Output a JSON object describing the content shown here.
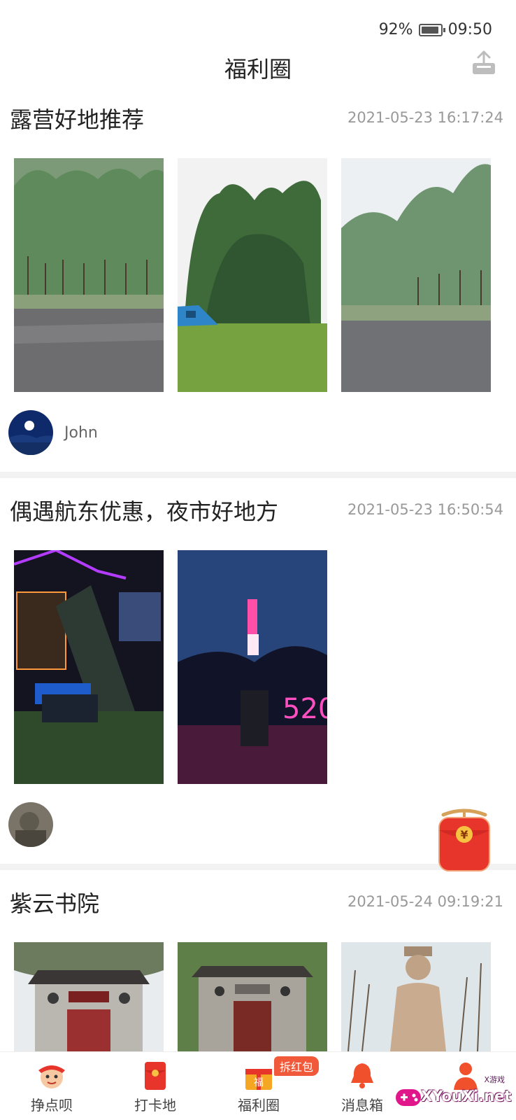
{
  "status": {
    "battery": "92%",
    "time": "09:50",
    "battery_level": 0.92
  },
  "header": {
    "title": "福利圈"
  },
  "posts": [
    {
      "title": "露营好地推荐",
      "time": "2021-05-23 16:17:24",
      "author": "John",
      "photos": [
        "riverside-trees-photo",
        "tent-on-lawn-photo",
        "tree-lined-river-photo"
      ]
    },
    {
      "title": "偶遇航东优惠，夜市好地方",
      "time": "2021-05-23 16:50:54",
      "author": "",
      "photos": [
        "night-market-sign-photo",
        "night-lights-trees-photo"
      ]
    },
    {
      "title": "紫云书院",
      "time": "2021-05-24 09:19:21",
      "author": "",
      "photos": [
        "academy-gate-photo",
        "academy-building-photo",
        "stone-statue-photo"
      ]
    }
  ],
  "tabbar": {
    "items": [
      {
        "label": "挣点呗",
        "icon": "mascot-icon"
      },
      {
        "label": "打卡地",
        "icon": "red-envelope-icon"
      },
      {
        "label": "福利圈",
        "icon": "fu-gift-icon",
        "badge": "拆红包"
      },
      {
        "label": "消息箱",
        "icon": "bell-icon"
      },
      {
        "label": "",
        "icon": "person-icon"
      }
    ]
  },
  "floating": {
    "symbol": "¥"
  },
  "watermark": {
    "text": "XYouXi.net",
    "small": "X游戏"
  },
  "colors": {
    "accent": "#e8352b",
    "badge": "#f05a3a",
    "divider": "#f2f2f2",
    "time": "#999999"
  }
}
